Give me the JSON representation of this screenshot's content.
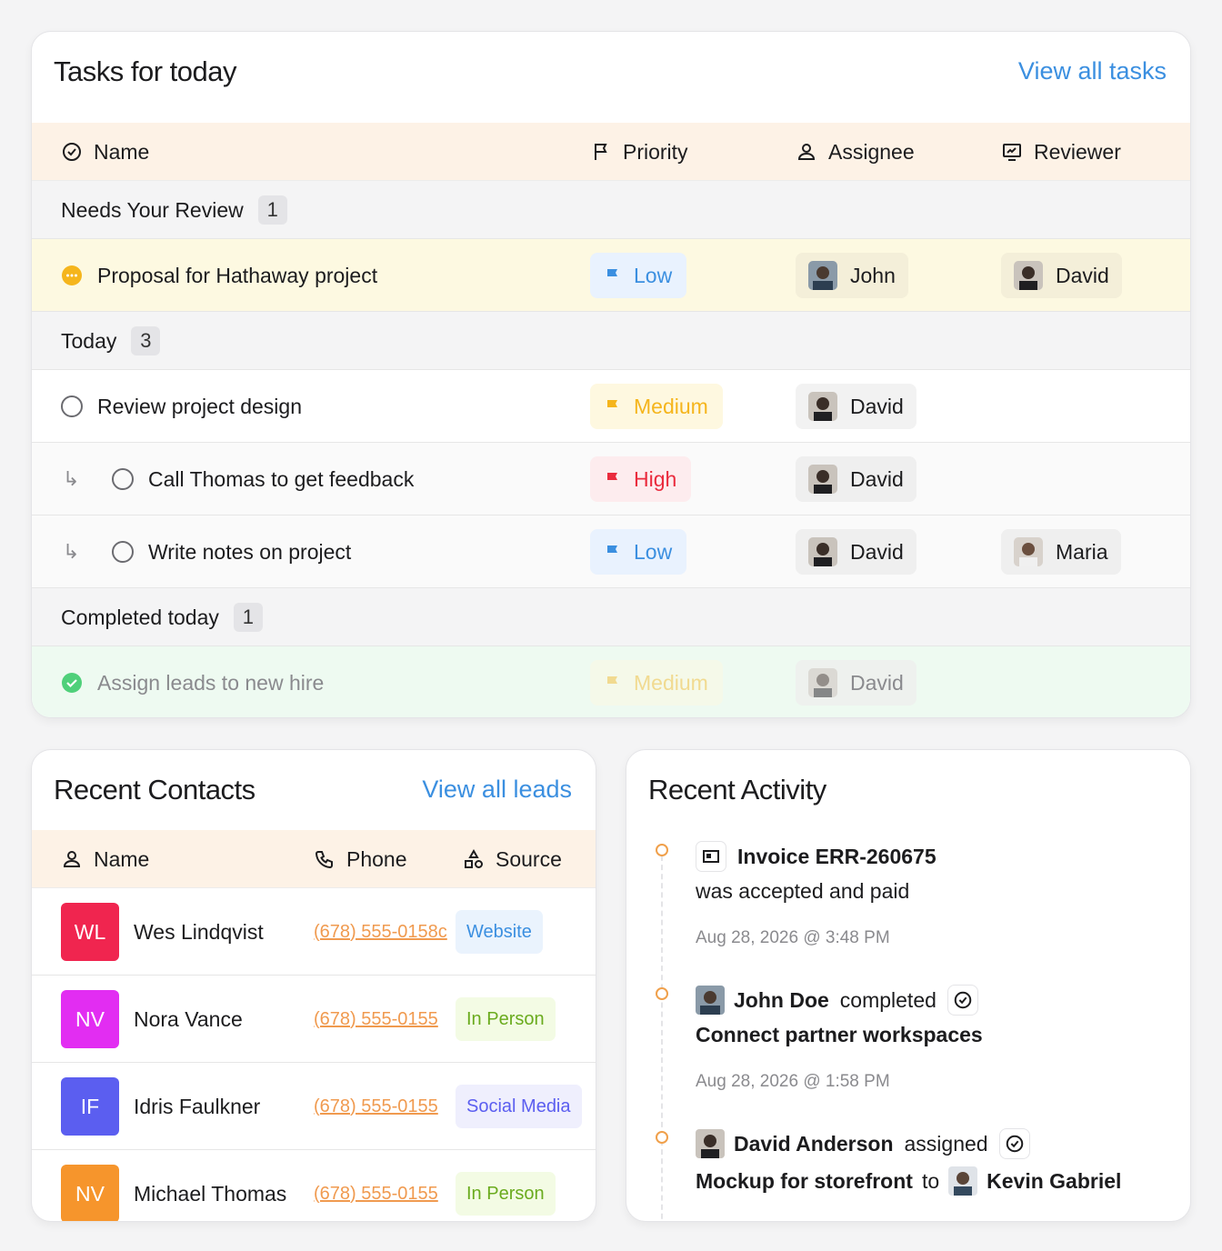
{
  "tasks_card": {
    "title": "Tasks for today",
    "view_all": "View all tasks",
    "columns": {
      "name": "Name",
      "priority": "Priority",
      "assignee": "Assignee",
      "reviewer": "Reviewer"
    },
    "groups": [
      {
        "label": "Needs Your Review",
        "count": "1",
        "rows": [
          {
            "name": "Proposal for Hathaway project",
            "priority": "Low",
            "assignee": "John",
            "reviewer": "David"
          }
        ]
      },
      {
        "label": "Today",
        "count": "3",
        "rows": [
          {
            "name": "Review project design",
            "priority": "Medium",
            "assignee": "David",
            "reviewer": ""
          },
          {
            "name": "Call Thomas to get feedback",
            "priority": "High",
            "assignee": "David",
            "reviewer": ""
          },
          {
            "name": "Write notes on project",
            "priority": "Low",
            "assignee": "David",
            "reviewer": "Maria"
          }
        ]
      },
      {
        "label": "Completed today",
        "count": "1",
        "rows": [
          {
            "name": "Assign leads to new hire",
            "priority": "Medium",
            "assignee": "David",
            "reviewer": ""
          }
        ]
      }
    ]
  },
  "contacts_card": {
    "title": "Recent Contacts",
    "view_all": "View all leads",
    "columns": {
      "name": "Name",
      "phone": "Phone",
      "source": "Source"
    },
    "rows": [
      {
        "initials": "WL",
        "name": "Wes Lindqvist",
        "phone": "(678) 555-0158c",
        "source": "Website",
        "color": "#f0254f"
      },
      {
        "initials": "NV",
        "name": "Nora Vance",
        "phone": "(678) 555-0155",
        "source": "In Person",
        "color": "#e22df2"
      },
      {
        "initials": "IF",
        "name": "Idris Faulkner",
        "phone": "(678) 555-0155",
        "source": "Social Media",
        "color": "#5b5ef0"
      },
      {
        "initials": "NV",
        "name": "Michael Thomas",
        "phone": "(678) 555-0155",
        "source": "In Person",
        "color": "#f6952c"
      }
    ]
  },
  "activity_card": {
    "title": "Recent Activity",
    "items": [
      {
        "subject": "Invoice ERR-260675",
        "detail": "was accepted and paid",
        "time": "Aug 28, 2026 @ 3:48 PM"
      },
      {
        "actor": "John Doe",
        "verb": "completed",
        "object": "Connect partner workspaces",
        "time": "Aug 28, 2026 @ 1:58 PM"
      },
      {
        "actor": "David Anderson",
        "verb": "assigned",
        "object": "Mockup for storefront",
        "connector": "to",
        "target": "Kevin Gabriel"
      }
    ]
  },
  "colors": {
    "accent": "#3b8fe0",
    "header_bg": "#fdf2e6",
    "review_bg": "#fdf9e1",
    "completed_bg": "#eefaf1"
  }
}
